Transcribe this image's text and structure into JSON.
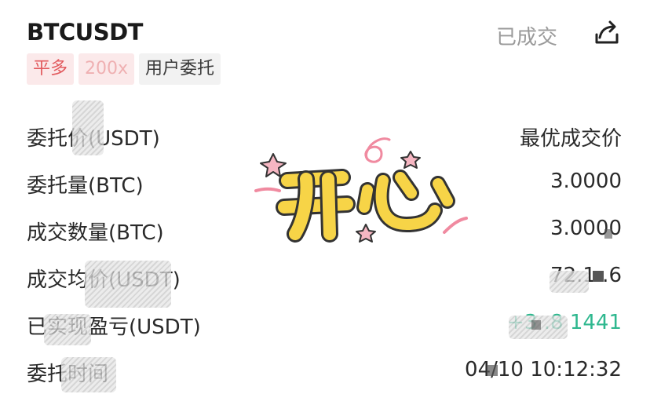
{
  "header": {
    "symbol": "BTCUSDT",
    "status": "已成交"
  },
  "tags": {
    "side": "平多",
    "leverage": "200x",
    "type": "用户委托"
  },
  "rows": [
    {
      "label": "委托价(USDT)",
      "value": "最优成交价"
    },
    {
      "label": "委托量(BTC)",
      "value": "3.0000"
    },
    {
      "label": "成交数量(BTC)",
      "value": "3.0000"
    },
    {
      "label": "成交均价(USDT)",
      "value": "72.1 .6"
    },
    {
      "label": "已实现盈亏(USDT)",
      "value": "+3 .8 1441"
    },
    {
      "label": "委托时间",
      "value": "04/10 10:12:32"
    }
  ],
  "sticker": {
    "text": "开心"
  },
  "colors": {
    "profit_green": "#2fb88f",
    "side_red": "#e25a5e",
    "sticker_yellow": "#f7d447"
  },
  "icons": {
    "share": "share-icon"
  }
}
